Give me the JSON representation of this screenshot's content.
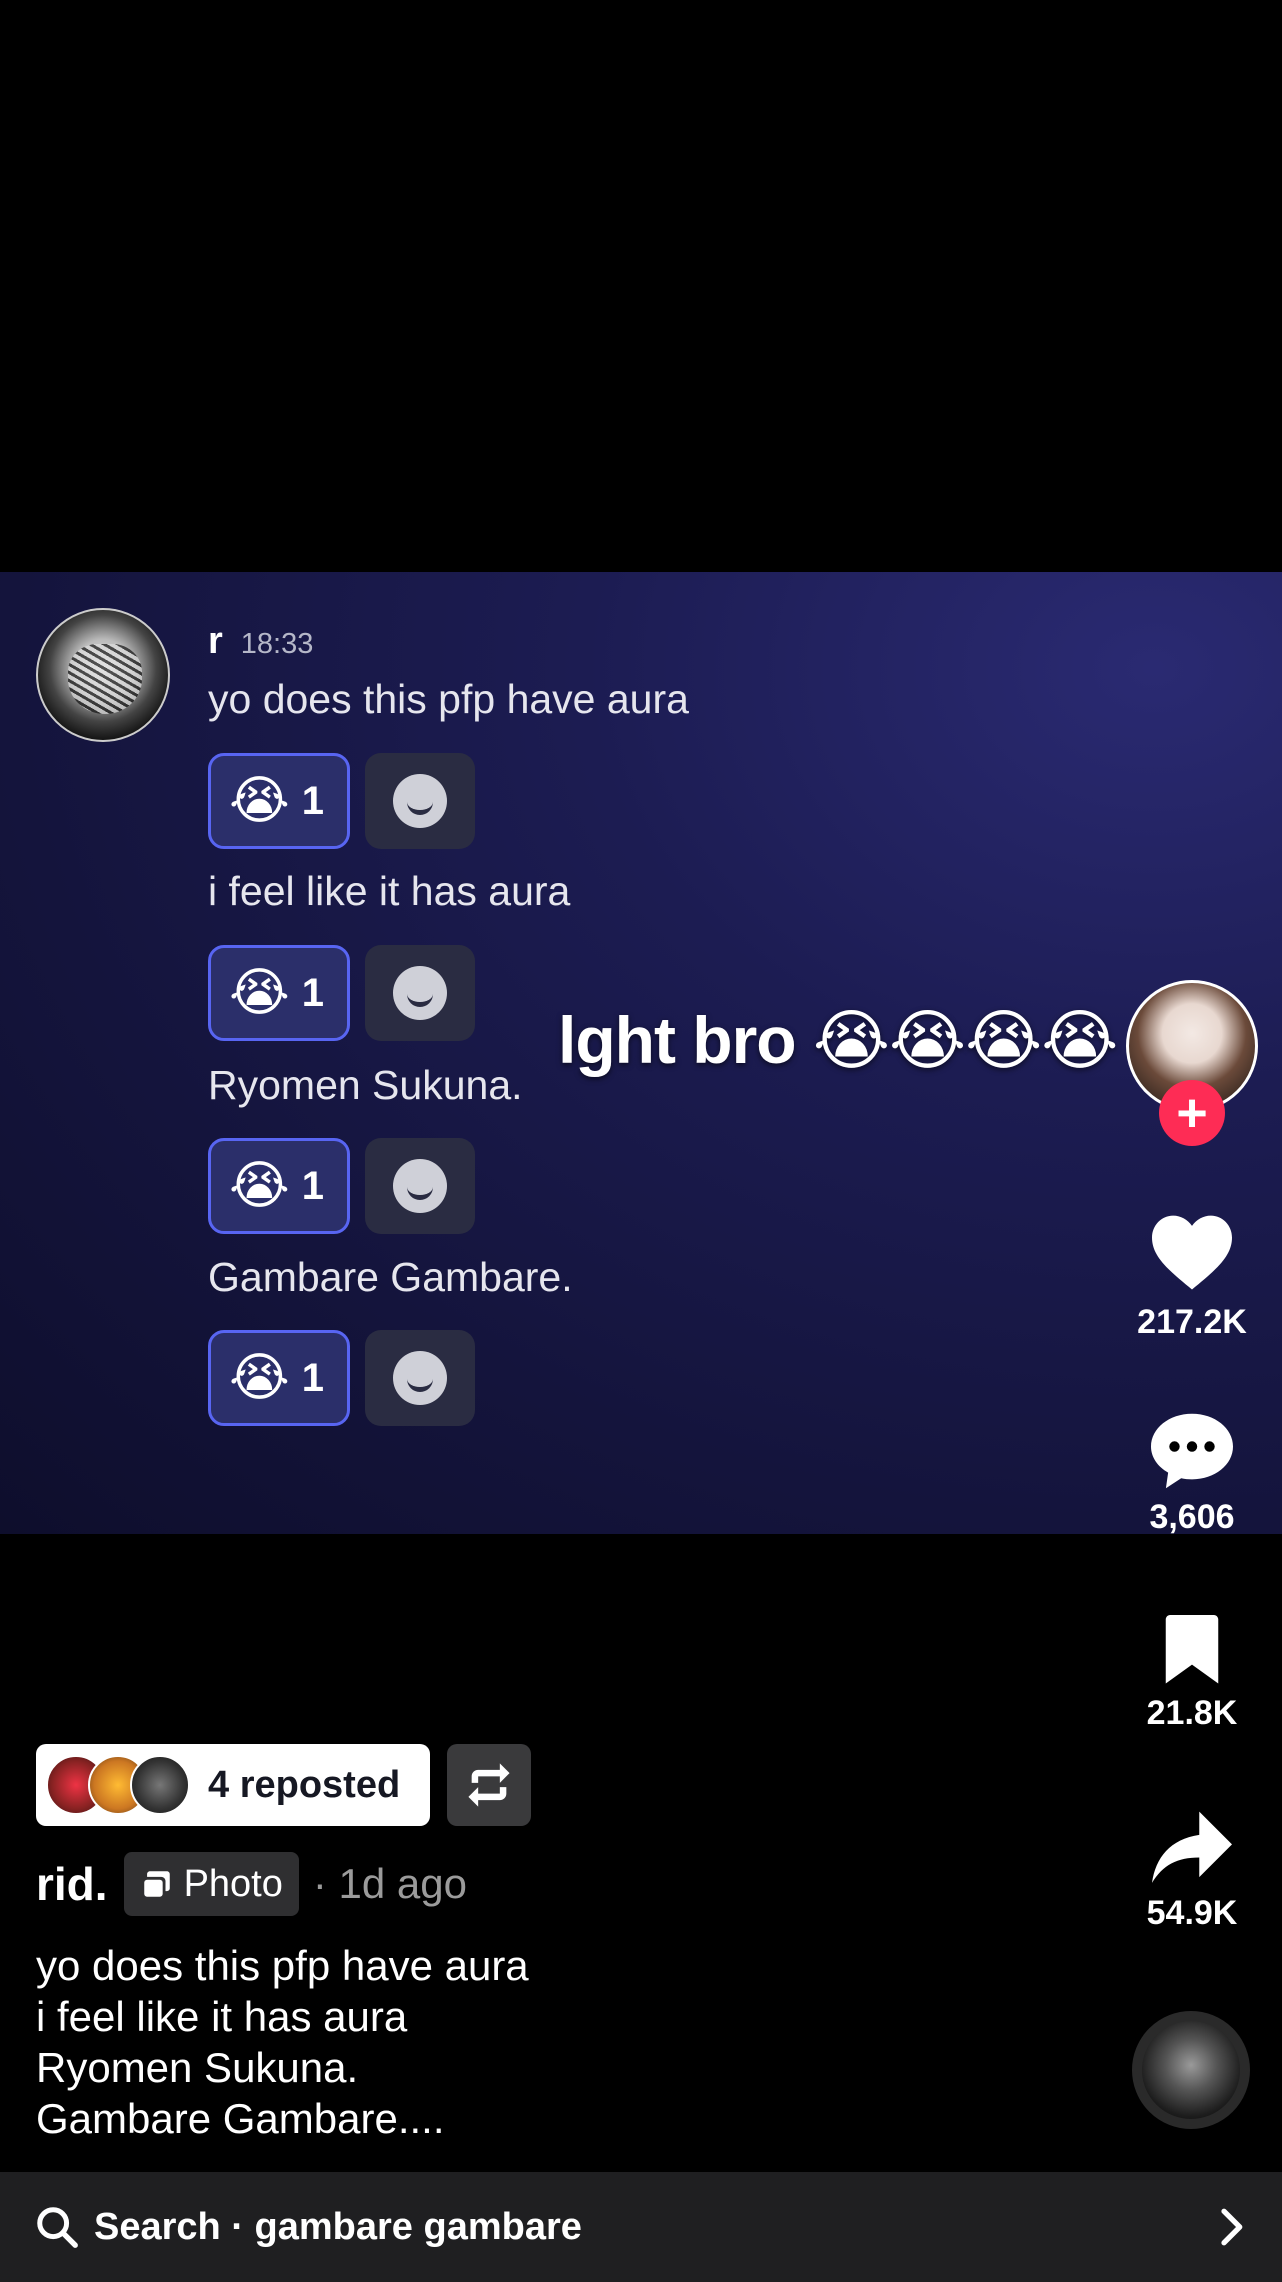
{
  "post_image": {
    "message": {
      "username": "r",
      "time": "18:33",
      "lines": [
        "yo does this pfp have aura",
        "i feel like it has aura",
        "Ryomen Sukuna.",
        "Gambare Gambare."
      ]
    },
    "reactions": [
      {
        "emoji": "😭",
        "count": "1"
      },
      {
        "emoji": "😭",
        "count": "1"
      },
      {
        "emoji": "😭",
        "count": "1"
      },
      {
        "emoji": "😭",
        "count": "1"
      }
    ],
    "overlay_caption": "lght bro 😭😭😭😭"
  },
  "actions": {
    "likes": "217.2K",
    "comments": "3,606",
    "saves": "21.8K",
    "shares": "54.9K",
    "follow_symbol": "+"
  },
  "repost": {
    "label": "4 reposted"
  },
  "post_meta": {
    "author": "rid.",
    "type_tag": "Photo",
    "time_ago": "· 1d ago"
  },
  "description": [
    "yo does this pfp have aura",
    "i feel like it has aura",
    "Ryomen Sukuna.",
    "Gambare Gambare...."
  ],
  "search": {
    "text": "Search · gambare gambare"
  },
  "colors": {
    "accent_red": "#fe2c55",
    "reaction_border": "#5865f2"
  }
}
